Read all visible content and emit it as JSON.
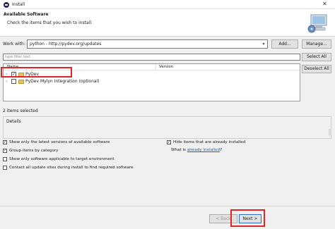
{
  "window": {
    "title": "Install",
    "close_glyph": "✕"
  },
  "banner": {
    "title": "Available Software",
    "description": "Check the items that you wish to install.",
    "icon": "install-wizard-icon"
  },
  "work_with": {
    "label": "Work with:",
    "value": "python - http://pydev.org/updates",
    "add_label": "Add...",
    "manage_label": "Manage..."
  },
  "filter": {
    "placeholder": "type filter text"
  },
  "buttons": {
    "select_all": "Select All",
    "deselect_all": "Deselect All"
  },
  "tree": {
    "columns": [
      "Name",
      "Version"
    ],
    "rows": [
      {
        "label": "PyDev",
        "checked": true,
        "version": ""
      },
      {
        "label": "PyDev Mylyn Integration (optional)",
        "checked": false,
        "version": ""
      }
    ]
  },
  "status": "2 items selected",
  "details": {
    "label": "Details"
  },
  "options": [
    {
      "label": "Show only the latest versions of available software",
      "checked": true
    },
    {
      "label": "Group items by category",
      "checked": true
    },
    {
      "label": "Show only software applicable to target environment",
      "checked": false
    },
    {
      "label": "Contact all update sites during install to find required software",
      "checked": false
    },
    {
      "label": "Hide items that are already installed",
      "checked": true
    }
  ],
  "whatis": {
    "prefix": "What is ",
    "link": "already installed",
    "suffix": "?"
  },
  "nav": {
    "back": "< Back",
    "next": "Next >"
  },
  "colors": {
    "highlight": "#e0242b",
    "link": "#1a5fb4"
  }
}
